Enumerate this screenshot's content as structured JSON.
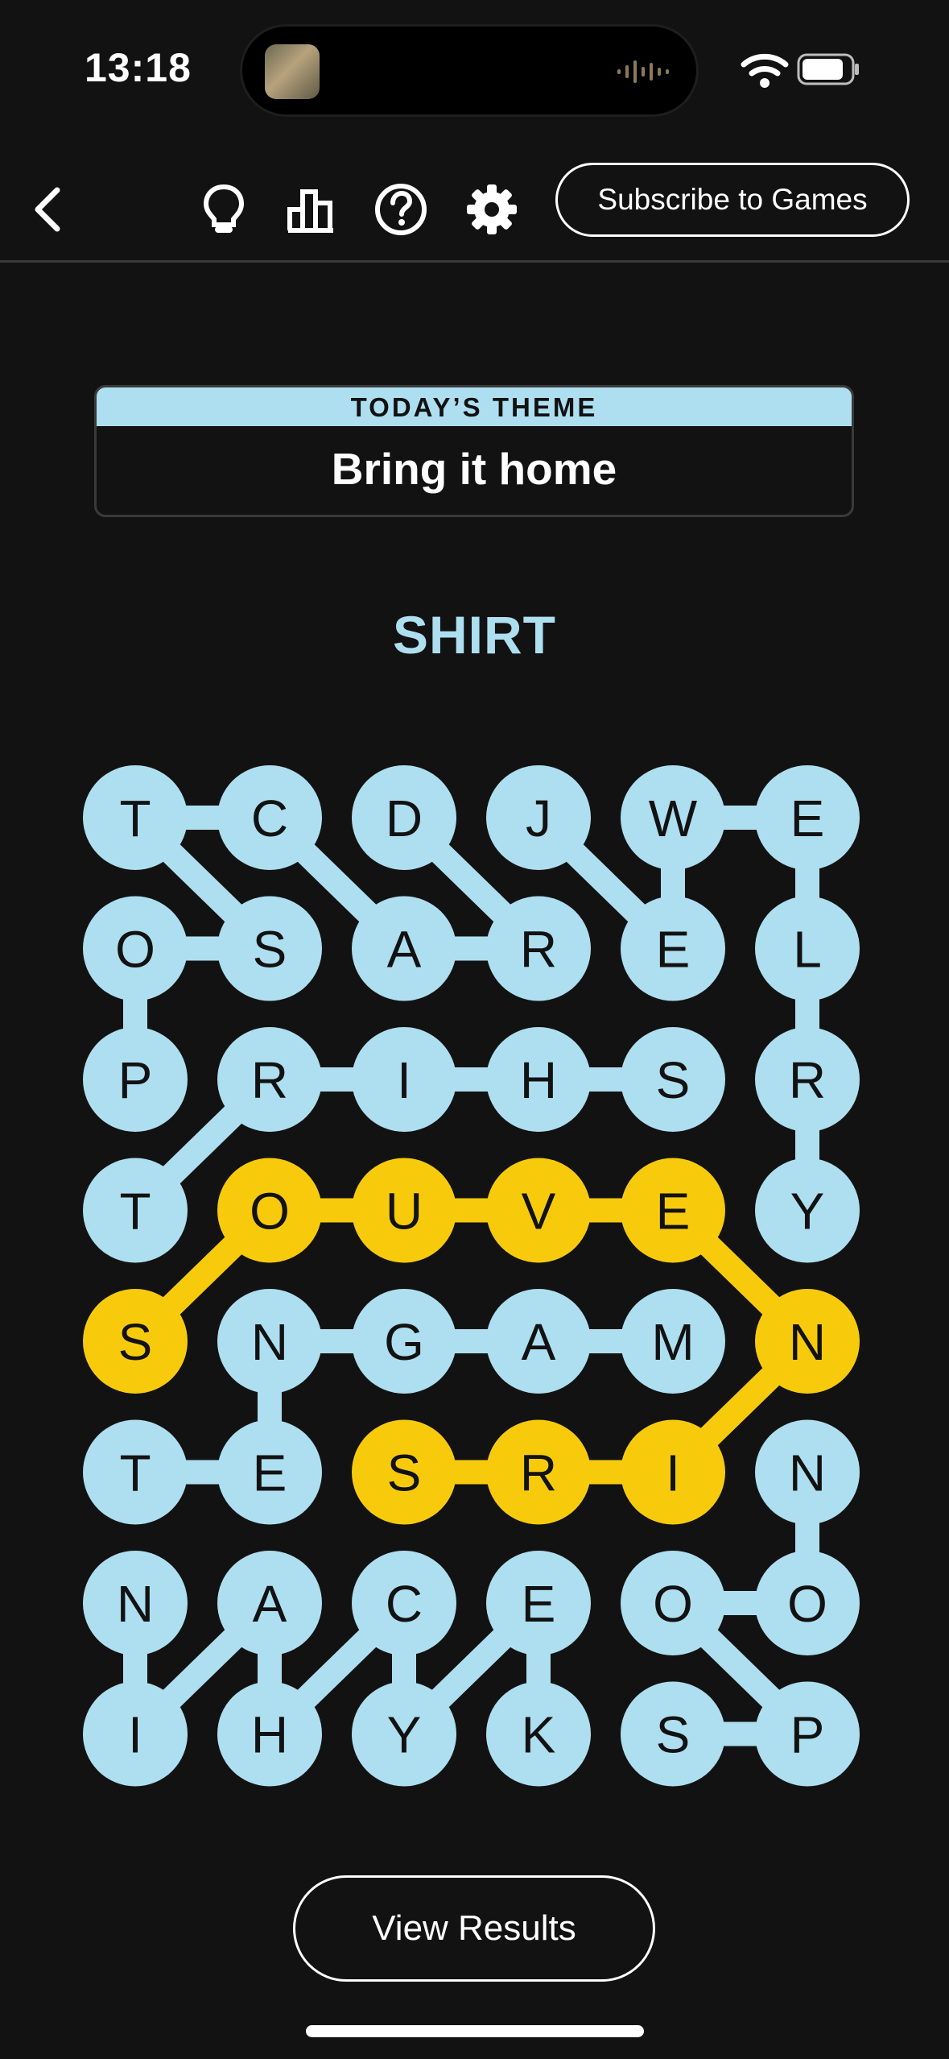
{
  "status_bar": {
    "time": "13:18"
  },
  "toolbar": {
    "subscribe_label": "Subscribe to Games",
    "icons": [
      "back-chevron-icon",
      "hint-lightbulb-icon",
      "stats-bar-chart-icon",
      "help-question-icon",
      "settings-gear-icon"
    ]
  },
  "theme": {
    "header": "TODAY’S THEME",
    "title": "Bring it home"
  },
  "current_word": "SHIRT",
  "colors": {
    "background": "#121212",
    "tile": "#aedff0",
    "spangram": "#f7cb0b",
    "text_dark": "#121212",
    "text_light": "#ffffff"
  },
  "grid": {
    "rows": [
      [
        "T",
        "C",
        "D",
        "J",
        "W",
        "E"
      ],
      [
        "O",
        "S",
        "A",
        "R",
        "E",
        "L"
      ],
      [
        "P",
        "R",
        "I",
        "H",
        "S",
        "R"
      ],
      [
        "T",
        "O",
        "U",
        "V",
        "E",
        "Y"
      ],
      [
        "S",
        "N",
        "G",
        "A",
        "M",
        "N"
      ],
      [
        "T",
        "E",
        "S",
        "R",
        "I",
        "N"
      ],
      [
        "N",
        "A",
        "C",
        "E",
        "O",
        "O"
      ],
      [
        "I",
        "H",
        "Y",
        "K",
        "S",
        "P"
      ]
    ],
    "highlighted_cells": [
      [
        3,
        1
      ],
      [
        3,
        2
      ],
      [
        3,
        3
      ],
      [
        3,
        4
      ],
      [
        4,
        0
      ],
      [
        4,
        5
      ],
      [
        5,
        2
      ],
      [
        5,
        3
      ],
      [
        5,
        4
      ]
    ],
    "blue_links": [
      [
        [
          0,
          0
        ],
        [
          0,
          1
        ]
      ],
      [
        [
          0,
          0
        ],
        [
          1,
          1
        ]
      ],
      [
        [
          0,
          1
        ],
        [
          1,
          2
        ]
      ],
      [
        [
          0,
          2
        ],
        [
          1,
          3
        ]
      ],
      [
        [
          0,
          3
        ],
        [
          1,
          4
        ]
      ],
      [
        [
          0,
          4
        ],
        [
          0,
          5
        ]
      ],
      [
        [
          0,
          4
        ],
        [
          1,
          4
        ]
      ],
      [
        [
          0,
          5
        ],
        [
          1,
          5
        ]
      ],
      [
        [
          1,
          0
        ],
        [
          1,
          1
        ]
      ],
      [
        [
          1,
          0
        ],
        [
          2,
          0
        ]
      ],
      [
        [
          1,
          2
        ],
        [
          1,
          3
        ]
      ],
      [
        [
          1,
          5
        ],
        [
          2,
          5
        ]
      ],
      [
        [
          2,
          1
        ],
        [
          2,
          2
        ]
      ],
      [
        [
          2,
          2
        ],
        [
          2,
          3
        ]
      ],
      [
        [
          2,
          3
        ],
        [
          2,
          4
        ]
      ],
      [
        [
          2,
          1
        ],
        [
          3,
          0
        ]
      ],
      [
        [
          2,
          5
        ],
        [
          3,
          5
        ]
      ],
      [
        [
          4,
          1
        ],
        [
          4,
          2
        ]
      ],
      [
        [
          4,
          2
        ],
        [
          4,
          3
        ]
      ],
      [
        [
          4,
          3
        ],
        [
          4,
          4
        ]
      ],
      [
        [
          4,
          1
        ],
        [
          5,
          1
        ]
      ],
      [
        [
          5,
          0
        ],
        [
          5,
          1
        ]
      ],
      [
        [
          5,
          5
        ],
        [
          6,
          5
        ]
      ],
      [
        [
          6,
          0
        ],
        [
          7,
          0
        ]
      ],
      [
        [
          6,
          1
        ],
        [
          7,
          0
        ]
      ],
      [
        [
          6,
          1
        ],
        [
          7,
          1
        ]
      ],
      [
        [
          6,
          2
        ],
        [
          7,
          1
        ]
      ],
      [
        [
          6,
          2
        ],
        [
          7,
          2
        ]
      ],
      [
        [
          6,
          3
        ],
        [
          7,
          2
        ]
      ],
      [
        [
          6,
          3
        ],
        [
          7,
          3
        ]
      ],
      [
        [
          6,
          4
        ],
        [
          6,
          5
        ]
      ],
      [
        [
          6,
          4
        ],
        [
          7,
          5
        ]
      ],
      [
        [
          7,
          4
        ],
        [
          7,
          5
        ]
      ]
    ],
    "spangram_path": [
      [
        4,
        0
      ],
      [
        3,
        1
      ],
      [
        3,
        2
      ],
      [
        3,
        3
      ],
      [
        3,
        4
      ],
      [
        4,
        5
      ],
      [
        5,
        4
      ],
      [
        5,
        3
      ],
      [
        5,
        2
      ]
    ]
  },
  "results_label": "View Results"
}
